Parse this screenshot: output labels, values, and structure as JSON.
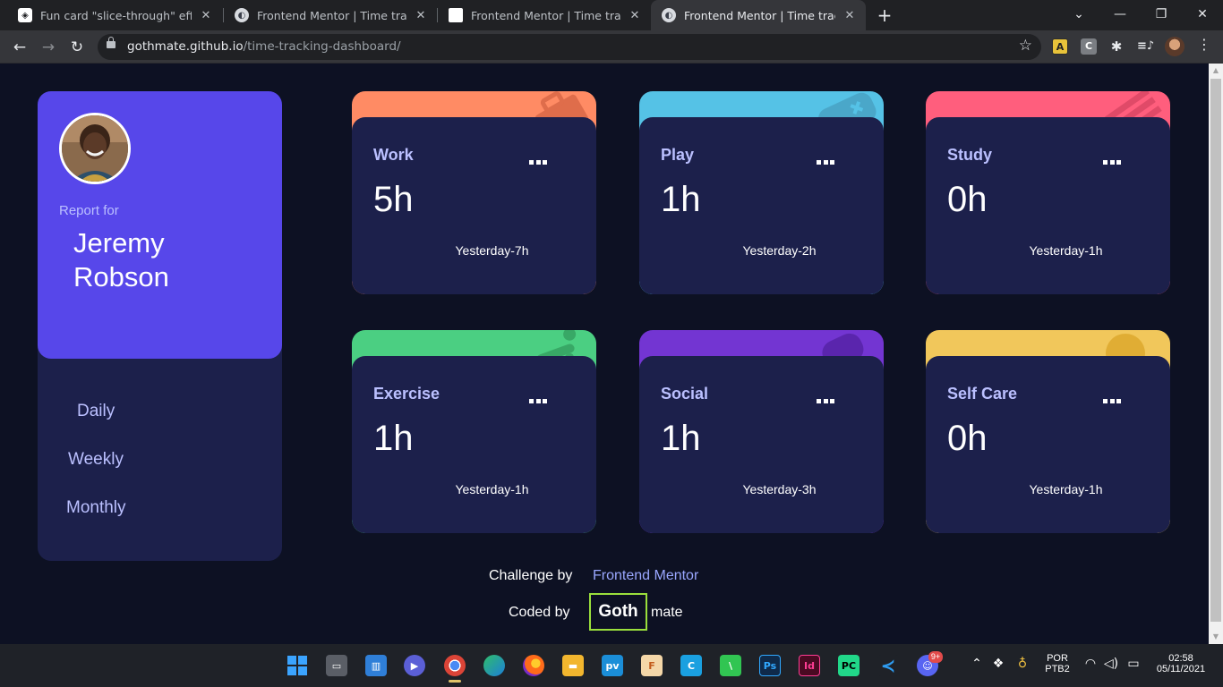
{
  "browser": {
    "tabs": [
      {
        "title": "Fun card \"slice-through\" effect",
        "favicon": "codepen-icon"
      },
      {
        "title": "Frontend Mentor | Time tracking",
        "favicon": "frontend-mentor-icon"
      },
      {
        "title": "Frontend Mentor | Time tracking",
        "favicon": "document-icon"
      },
      {
        "title": "Frontend Mentor | Time tracking",
        "favicon": "frontend-mentor-icon",
        "active": true
      }
    ],
    "url_host": "gothmate.github.io",
    "url_path": "/time-tracking-dashboard/",
    "ext_a": "A",
    "ext_c": "C"
  },
  "profile": {
    "report_label": "Report for",
    "name": "Jeremy Robson",
    "periods": [
      "Daily",
      "Weekly",
      "Monthly"
    ]
  },
  "activities": [
    {
      "title": "Work",
      "hours": "5h",
      "previous": "Yesterday-7h",
      "color": "#ff8b64",
      "icon": "briefcase-icon"
    },
    {
      "title": "Play",
      "hours": "1h",
      "previous": "Yesterday-2h",
      "color": "#55c2e6",
      "icon": "gamepad-icon"
    },
    {
      "title": "Study",
      "hours": "0h",
      "previous": "Yesterday-1h",
      "color": "#ff5e7d",
      "icon": "book-icon"
    },
    {
      "title": "Exercise",
      "hours": "1h",
      "previous": "Yesterday-1h",
      "color": "#4bcf82",
      "icon": "runner-icon"
    },
    {
      "title": "Social",
      "hours": "1h",
      "previous": "Yesterday-3h",
      "color": "#7335d2",
      "icon": "chat-icon"
    },
    {
      "title": "Self Care",
      "hours": "0h",
      "previous": "Yesterday-1h",
      "color": "#f1c75b",
      "icon": "heart-icon"
    }
  ],
  "footer": {
    "challenge_label": "Challenge by",
    "challenge_link": "Frontend Mentor",
    "coded_label": "Coded by",
    "logo_text": "Goth",
    "coder_suffix": "mate"
  },
  "taskbar": {
    "lang_top": "POR",
    "lang_bottom": "PTB2",
    "time": "02:58",
    "date": "05/11/2021",
    "discord_badge": "9+"
  },
  "colors": {
    "page_bg": "#0d1123",
    "card_bg": "#1c204b",
    "accent_purple": "#5747ea",
    "muted_text": "#bbc0ff"
  }
}
